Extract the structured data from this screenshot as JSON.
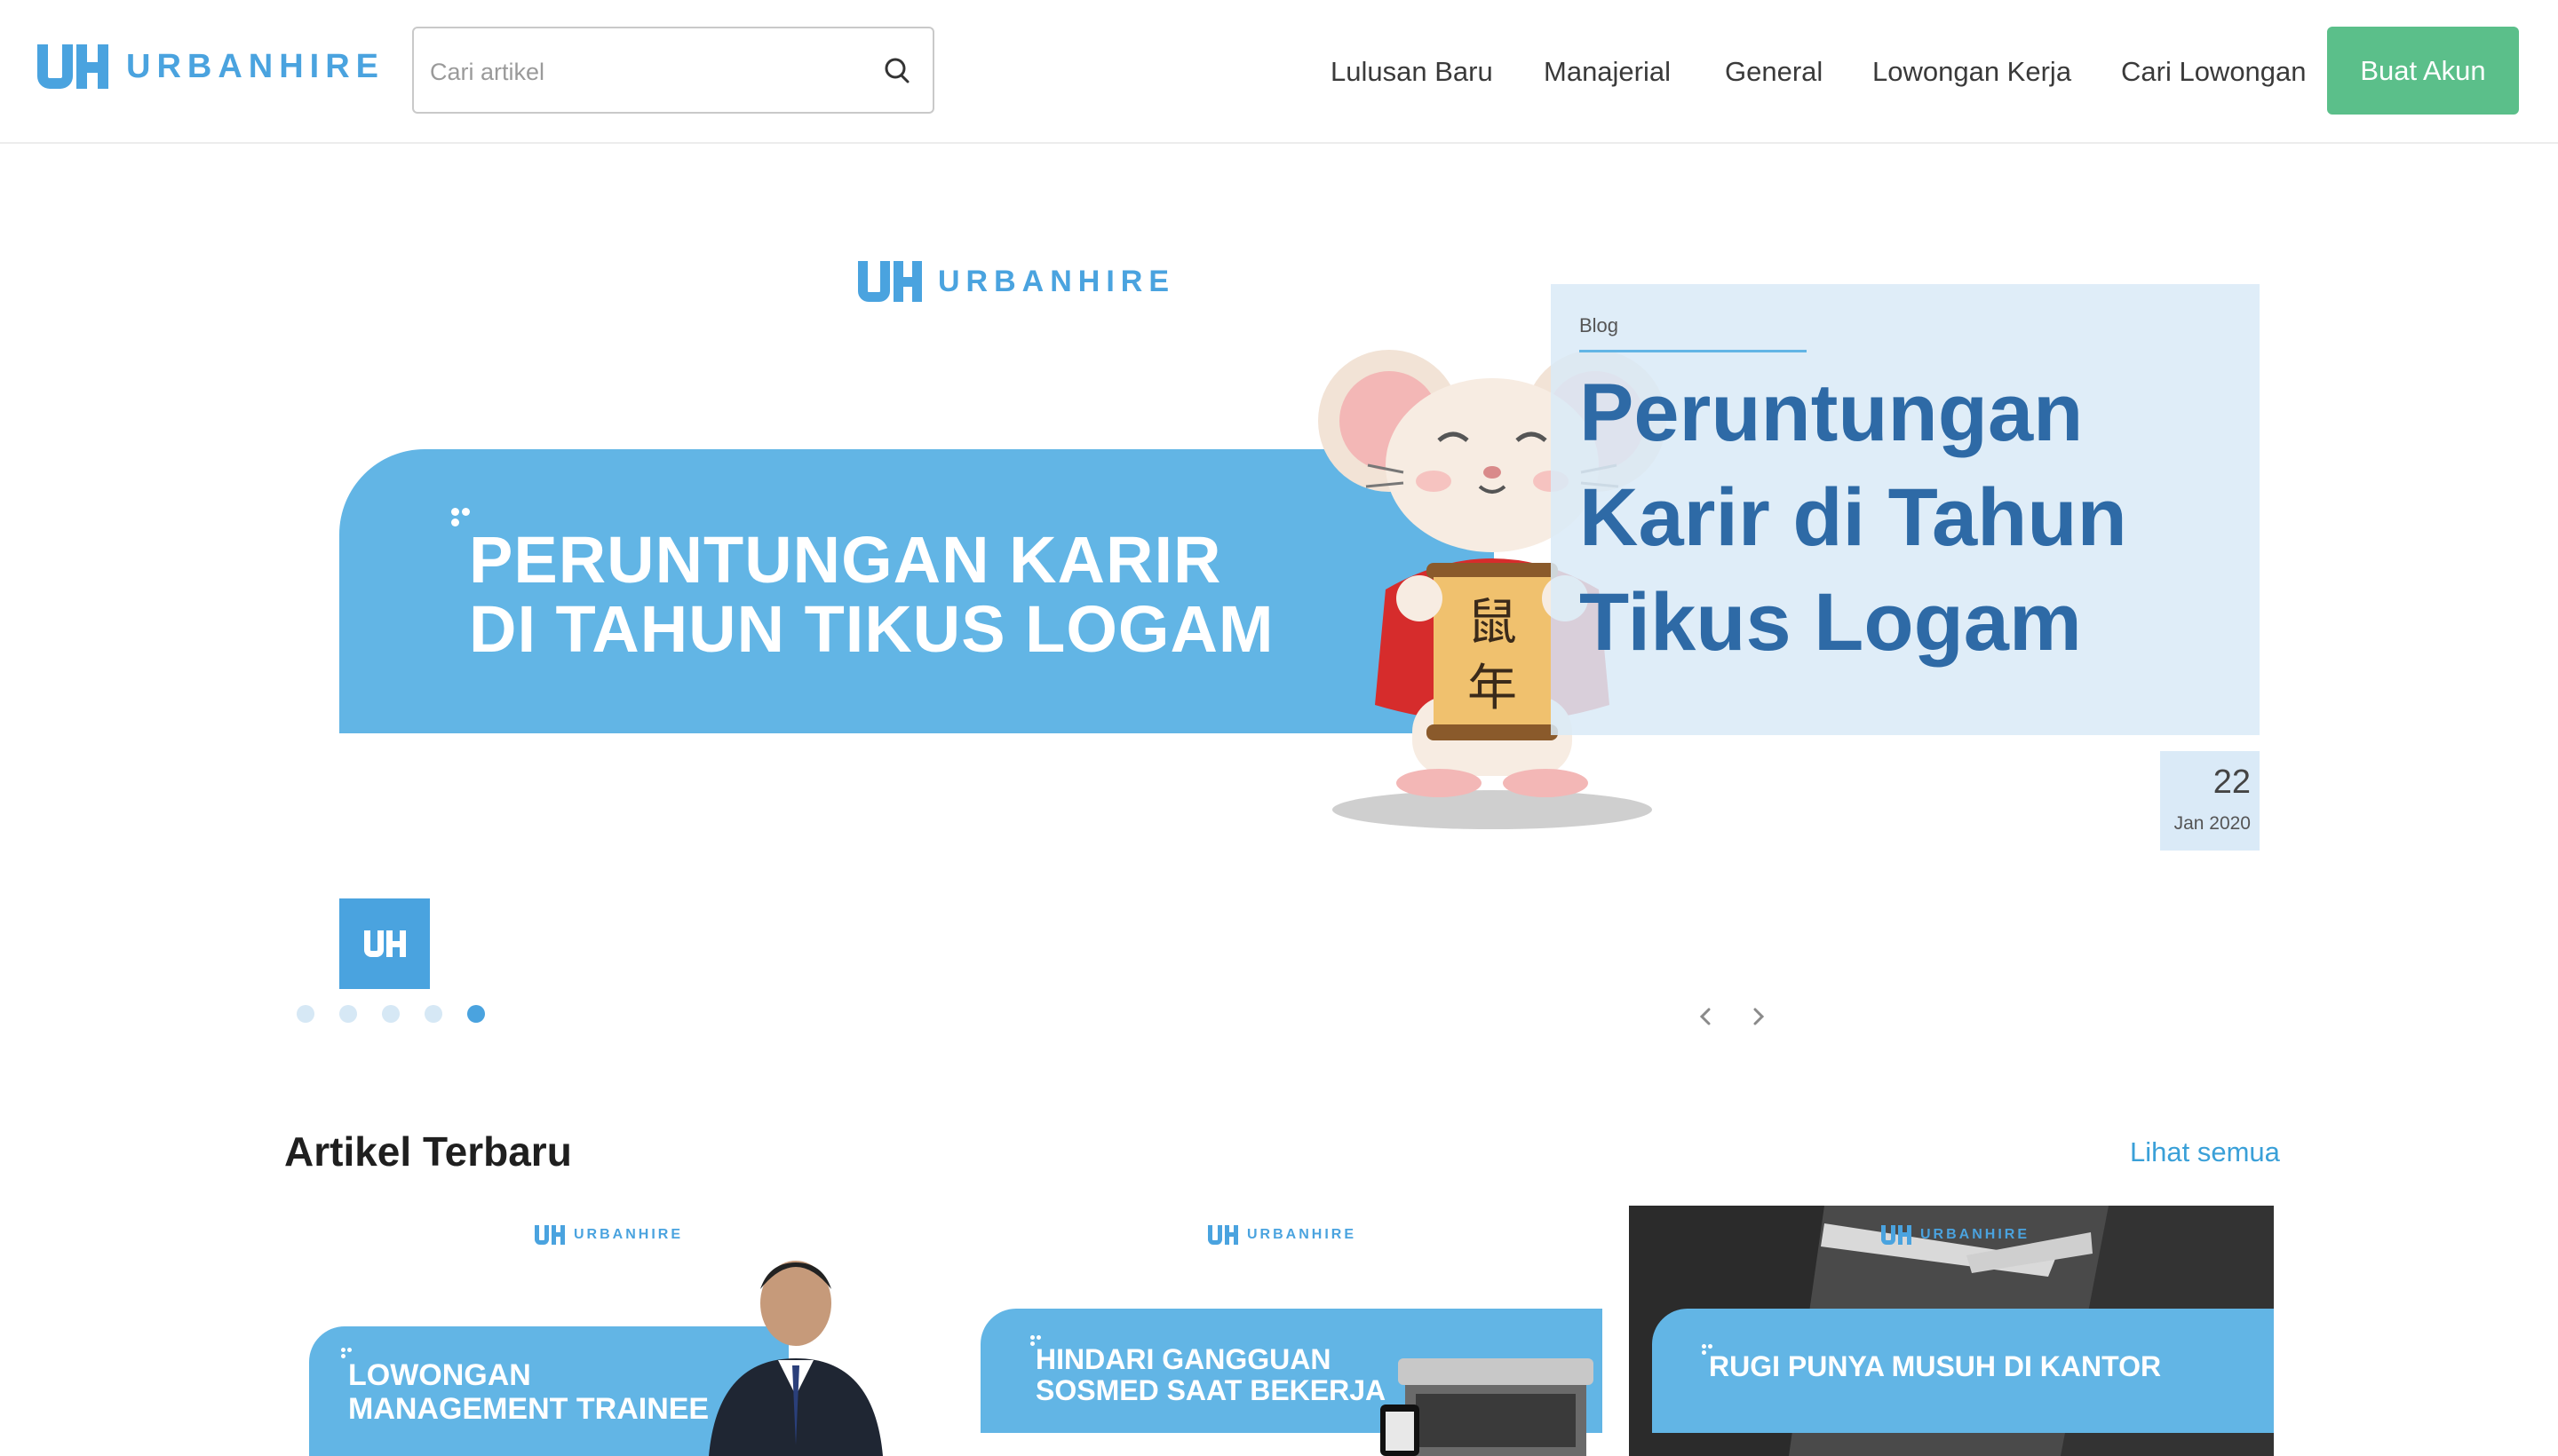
{
  "brand": {
    "name": "URBANHIRE",
    "color": "#4aa3df",
    "cta_color": "#5bbf8a"
  },
  "search": {
    "placeholder": "Cari artikel",
    "icon": "search-icon"
  },
  "nav": {
    "items": [
      {
        "label": "Lulusan Baru"
      },
      {
        "label": "Manajerial"
      },
      {
        "label": "General"
      },
      {
        "label": "Lowongan Kerja"
      },
      {
        "label": "Cari Lowongan"
      }
    ],
    "cta_label": "Buat Akun"
  },
  "hero": {
    "banner_brand": "URBANHIRE",
    "banner_title_line1": "PERUNTUNGAN KARIR",
    "banner_title_line2": "DI TAHUN TIKUS LOGAM",
    "scroll_text_1": "鼠",
    "scroll_text_2": "年",
    "card": {
      "category": "Blog",
      "title": "Peruntungan Karir di Tahun Tikus Logam"
    },
    "date": {
      "day": "22",
      "month_year": "Jan 2020"
    },
    "slide_count": 5,
    "active_slide": 5
  },
  "latest": {
    "title": "Artikel Terbaru",
    "see_all": "Lihat semua",
    "articles": [
      {
        "brand": "URBANHIRE",
        "title_line1": "LOWONGAN",
        "title_line2": "MANAGEMENT TRAINEE"
      },
      {
        "brand": "URBANHIRE",
        "title_line1": "HINDARI GANGGUAN",
        "title_line2": "SOSMED SAAT BEKERJA"
      },
      {
        "brand": "URBANHIRE",
        "title_line1": "RUGI PUNYA MUSUH DI KANTOR",
        "title_line2": ""
      }
    ]
  }
}
